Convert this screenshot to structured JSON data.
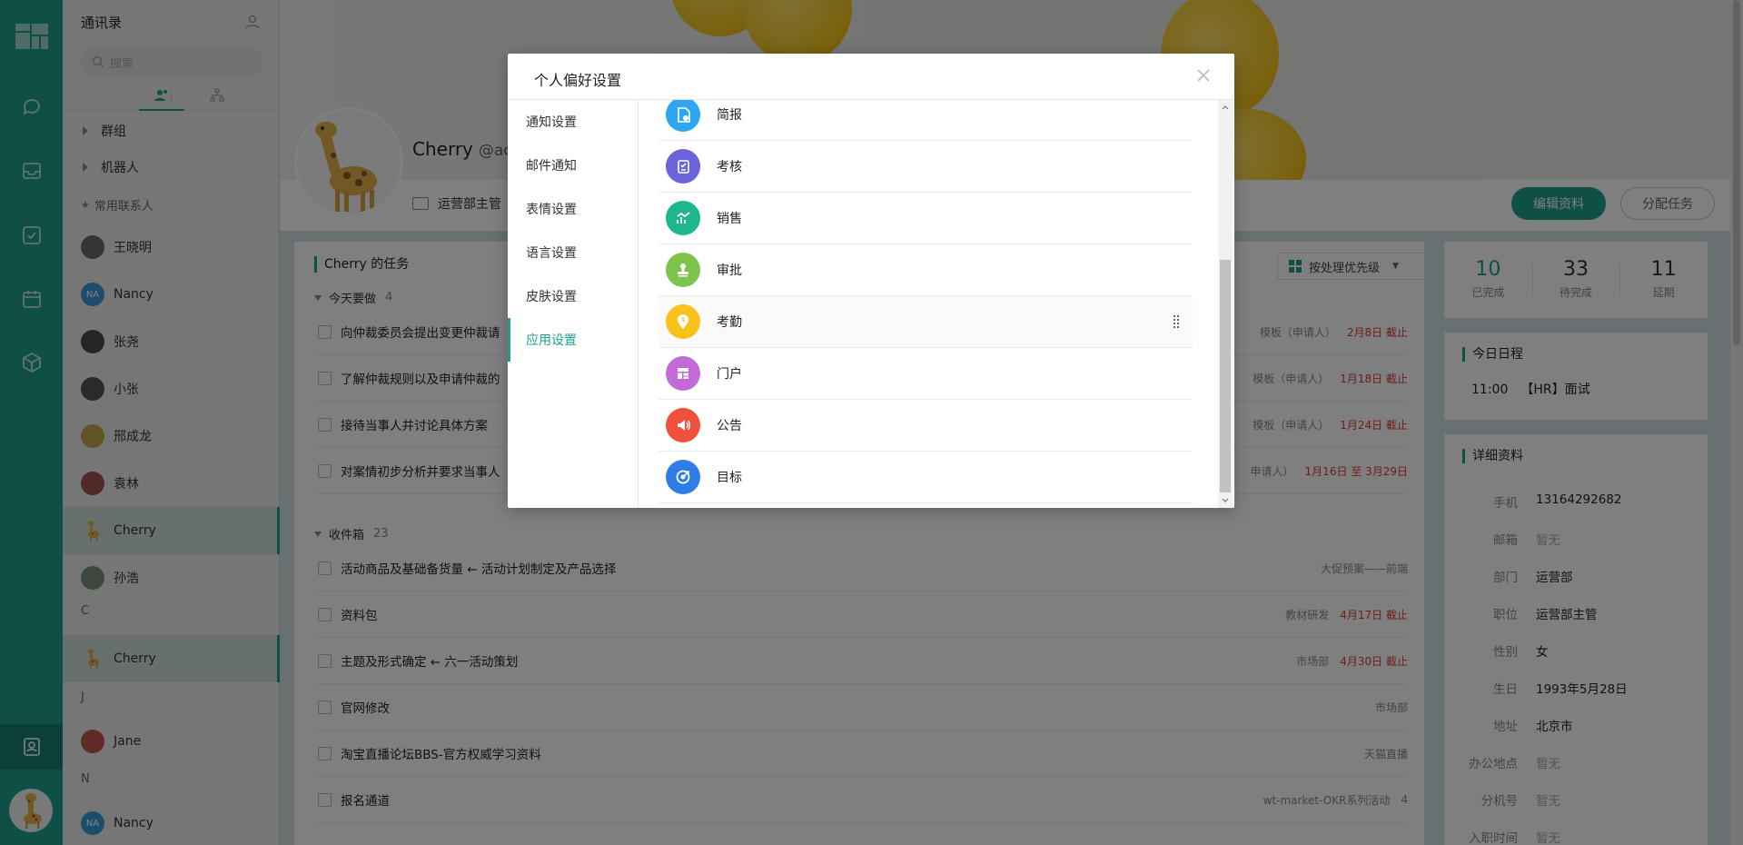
{
  "contacts_panel": {
    "title": "通讯录",
    "search_placeholder": "搜索",
    "groups": [
      {
        "label": "群组"
      },
      {
        "label": "机器人"
      }
    ],
    "favorites_label": "常用联系人",
    "favorites": [
      {
        "name": "王晓明",
        "avatar": "photo",
        "color": "#6d6d6d"
      },
      {
        "name": "Nancy",
        "avatar": "NA",
        "color": "#3a9ad9"
      },
      {
        "name": "张尧",
        "avatar": "photo",
        "color": "#4a4a4a"
      },
      {
        "name": "小张",
        "avatar": "photo",
        "color": "#555555"
      },
      {
        "name": "邢成龙",
        "avatar": "photo",
        "color": "#c9a64a"
      },
      {
        "name": "袁林",
        "avatar": "photo",
        "color": "#a0524e"
      },
      {
        "name": "Cherry",
        "avatar": "giraffe",
        "color": "#e0b04a",
        "active": true
      },
      {
        "name": "孙浩",
        "avatar": "photo",
        "color": "#7d8f7a"
      }
    ],
    "sections": [
      {
        "letter": "C",
        "contacts": [
          {
            "name": "Cherry",
            "avatar": "giraffe",
            "color": "#e0b04a",
            "active": true
          }
        ]
      },
      {
        "letter": "J",
        "contacts": [
          {
            "name": "Jane",
            "avatar": "photo",
            "color": "#c0584a"
          }
        ]
      },
      {
        "letter": "N",
        "contacts": [
          {
            "name": "Nancy",
            "avatar": "NA",
            "color": "#3a9ad9"
          }
        ]
      }
    ]
  },
  "profile": {
    "name": "Cherry",
    "handle": "@ad",
    "role": "运营部主管",
    "edit_button": "编辑资料",
    "assign_button": "分配任务"
  },
  "tasks": {
    "title": "Cherry 的任务",
    "sort_label": "按处理优先级",
    "today": {
      "label": "今天要做",
      "count": "4",
      "items": [
        {
          "text": "向仲裁委员会提出变更仲裁请",
          "meta": "模板（申请人）",
          "due": "2月8日 截止"
        },
        {
          "text": "了解仲裁规则以及申请仲裁的",
          "meta": "模板（申请人）",
          "due": "1月18日 截止"
        },
        {
          "text": "接待当事人并讨论具体方案",
          "meta": "模板（申请人）",
          "due": "1月24日 截止"
        },
        {
          "text": "对案情初步分析并要求当事人",
          "meta": "申请人）",
          "due": "1月16日 至 3月29日"
        }
      ]
    },
    "inbox": {
      "label": "收件箱",
      "count": "23",
      "items": [
        {
          "text": "活动商品及基础备货量 ← 活动计划制定及产品选择",
          "meta": "大促预案——前端",
          "due": ""
        },
        {
          "text": "资料包",
          "meta": "教材研发",
          "due": "4月17日 截止"
        },
        {
          "text": "主题及形式确定 ← 六一活动策划",
          "meta": "市场部",
          "due": "4月30日 截止"
        },
        {
          "text": "官网修改",
          "meta": "市场部",
          "due": ""
        },
        {
          "text": "淘宝直播论坛BBS-官方权威学习资料",
          "meta": "天猫直播",
          "due": ""
        },
        {
          "text": "报名通道",
          "meta": "wt-market-OKR系列活动",
          "due": "4"
        }
      ]
    }
  },
  "stats": [
    {
      "num": "10",
      "label": "已完成"
    },
    {
      "num": "33",
      "label": "待完成"
    },
    {
      "num": "11",
      "label": "延期"
    }
  ],
  "schedule": {
    "title": "今日日程",
    "time": "11:00",
    "event": "【HR】面试"
  },
  "details": {
    "title": "详细资料",
    "rows": [
      {
        "k": "手机",
        "v": "13164292682"
      },
      {
        "k": "邮箱",
        "v": "暂无"
      },
      {
        "k": "部门",
        "v": "运营部"
      },
      {
        "k": "职位",
        "v": "运营部主管"
      },
      {
        "k": "性别",
        "v": "女"
      },
      {
        "k": "生日",
        "v": "1993年5月28日"
      },
      {
        "k": "地址",
        "v": "北京市"
      },
      {
        "k": "办公地点",
        "v": "暂无"
      },
      {
        "k": "分机号",
        "v": "暂无"
      },
      {
        "k": "入职时间",
        "v": "暂无"
      }
    ]
  },
  "modal": {
    "title": "个人偏好设置",
    "menu": [
      {
        "label": "通知设置"
      },
      {
        "label": "邮件通知"
      },
      {
        "label": "表情设置"
      },
      {
        "label": "语言设置"
      },
      {
        "label": "皮肤设置"
      },
      {
        "label": "应用设置",
        "active": true
      }
    ],
    "apps": [
      {
        "label": "简报",
        "icon": "report-icon",
        "color": "#2ea7f0"
      },
      {
        "label": "考核",
        "icon": "assessment-icon",
        "color": "#6a63d9"
      },
      {
        "label": "销售",
        "icon": "sales-chart-icon",
        "color": "#1fb58f"
      },
      {
        "label": "审批",
        "icon": "approval-stamp-icon",
        "color": "#7cc44c"
      },
      {
        "label": "考勤",
        "icon": "location-clock-icon",
        "color": "#f7c21a",
        "hover": true
      },
      {
        "label": "门户",
        "icon": "portal-layout-icon",
        "color": "#c36ad8"
      },
      {
        "label": "公告",
        "icon": "announcement-icon",
        "color": "#f0503c"
      },
      {
        "label": "目标",
        "icon": "target-icon",
        "color": "#2f7ee8"
      }
    ]
  }
}
